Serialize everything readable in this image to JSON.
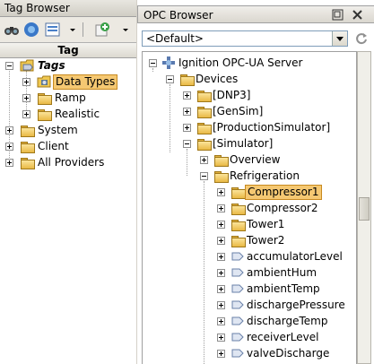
{
  "tag_browser": {
    "title": "Tag Browser",
    "column_header": "Tag",
    "tree": [
      {
        "label": "Tags",
        "level": 0,
        "expanded": true
      },
      {
        "label": "Data Types",
        "level": 1,
        "expanded": false,
        "selected": true
      },
      {
        "label": "Ramp",
        "level": 1,
        "expanded": false
      },
      {
        "label": "Realistic",
        "level": 1,
        "expanded": false
      },
      {
        "label": "System",
        "level": 0,
        "expanded": false
      },
      {
        "label": "Client",
        "level": 0,
        "expanded": false
      },
      {
        "label": "All Providers",
        "level": 0,
        "expanded": false
      }
    ]
  },
  "opc_browser": {
    "title": "OPC Browser",
    "server_select": "<Default>",
    "tree": [
      {
        "label": "Ignition OPC-UA Server",
        "level": 0,
        "kind": "server",
        "expanded": true
      },
      {
        "label": "Devices",
        "level": 1,
        "kind": "folder",
        "expanded": true
      },
      {
        "label": "[DNP3]",
        "level": 2,
        "kind": "folder",
        "expanded": false
      },
      {
        "label": "[GenSim]",
        "level": 2,
        "kind": "folder",
        "expanded": false
      },
      {
        "label": "[ProductionSimulator]",
        "level": 2,
        "kind": "folder",
        "expanded": false
      },
      {
        "label": "[Simulator]",
        "level": 2,
        "kind": "folder",
        "expanded": true
      },
      {
        "label": "Overview",
        "level": 3,
        "kind": "folder",
        "expanded": false
      },
      {
        "label": "Refrigeration",
        "level": 3,
        "kind": "folder",
        "expanded": true
      },
      {
        "label": "Compressor1",
        "level": 4,
        "kind": "folder",
        "expanded": false,
        "selected": true
      },
      {
        "label": "Compressor2",
        "level": 4,
        "kind": "folder",
        "expanded": false
      },
      {
        "label": "Tower1",
        "level": 4,
        "kind": "folder",
        "expanded": false
      },
      {
        "label": "Tower2",
        "level": 4,
        "kind": "folder",
        "expanded": false
      },
      {
        "label": "accumulatorLevel",
        "level": 4,
        "kind": "tag",
        "expanded": false
      },
      {
        "label": "ambientHum",
        "level": 4,
        "kind": "tag",
        "expanded": false
      },
      {
        "label": "ambientTemp",
        "level": 4,
        "kind": "tag",
        "expanded": false
      },
      {
        "label": "dischargePressure",
        "level": 4,
        "kind": "tag",
        "expanded": false
      },
      {
        "label": "dischargeTemp",
        "level": 4,
        "kind": "tag",
        "expanded": false
      },
      {
        "label": "receiverLevel",
        "level": 4,
        "kind": "tag",
        "expanded": false
      },
      {
        "label": "valveDischarge",
        "level": 4,
        "kind": "tag",
        "expanded": false
      }
    ]
  },
  "colors": {
    "selection": "#f5c872",
    "folder": "#f0c850",
    "panel": "#d4d0c8"
  }
}
